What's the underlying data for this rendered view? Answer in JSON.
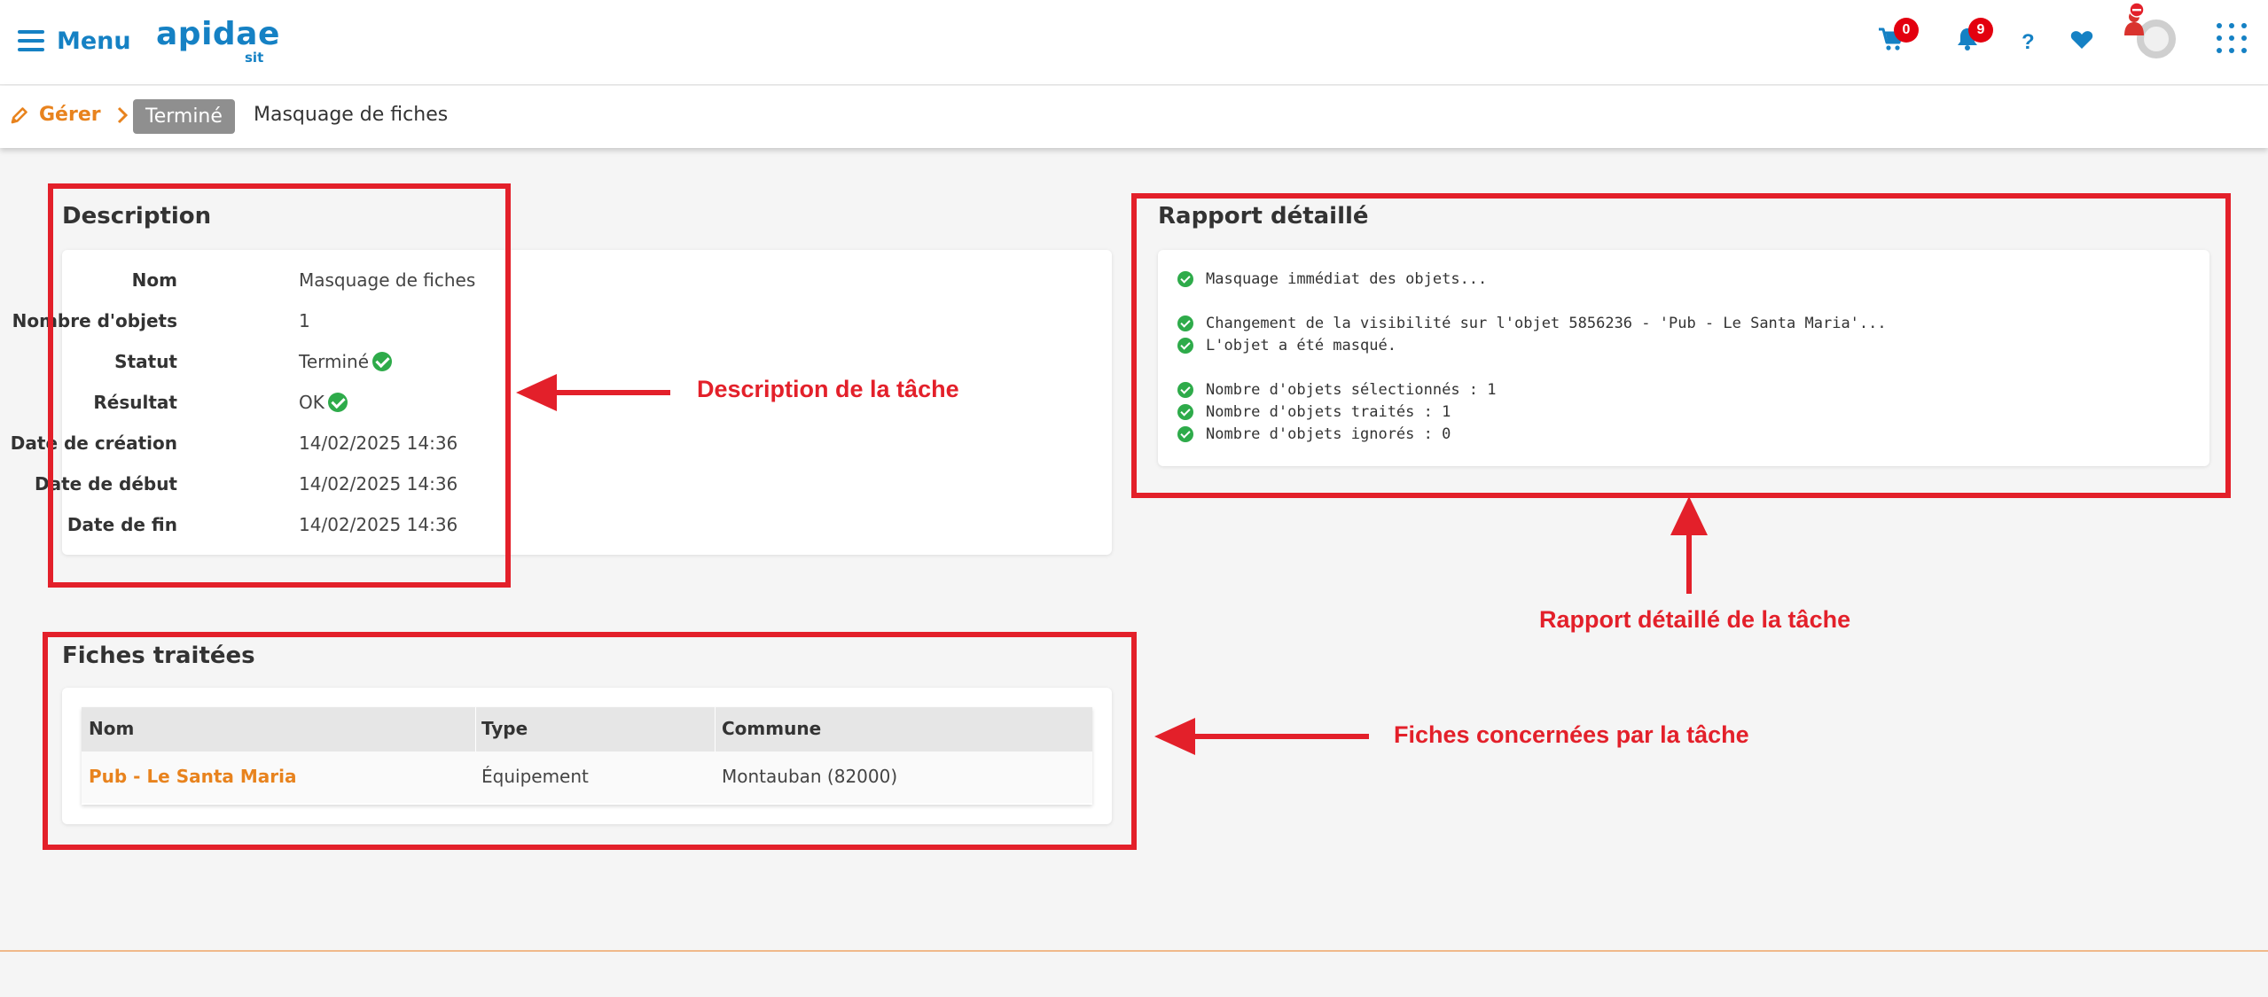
{
  "topbar": {
    "menu_label": "Menu",
    "logo_text": "apidae",
    "logo_sub": "sit",
    "cart_count": "0",
    "notif_count": "9",
    "help_label": "?",
    "accent_color": "#1581c4",
    "badge_color": "#e3000f"
  },
  "breadcrumb": {
    "root": "Gérer",
    "status": "Terminé",
    "current": "Masquage de fiches"
  },
  "description": {
    "title": "Description",
    "rows": [
      {
        "label": "Nom",
        "value": "Masquage de fiches"
      },
      {
        "label": "Nombre d'objets",
        "value": "1"
      },
      {
        "label": "Statut",
        "value": "Terminé"
      },
      {
        "label": "Résultat",
        "value": "OK"
      },
      {
        "label": "Date de création",
        "value": "14/02/2025 14:36"
      },
      {
        "label": "Date de début",
        "value": "14/02/2025 14:36"
      },
      {
        "label": "Date de fin",
        "value": "14/02/2025 14:36"
      }
    ]
  },
  "report": {
    "title": "Rapport détaillé",
    "lines": [
      "Masquage immédiat des objets...",
      "Changement de la visibilité sur l'objet 5856236 - 'Pub - Le Santa Maria'...",
      "L'objet a été masqué.",
      "Nombre d'objets sélectionnés : 1",
      "Nombre d'objets traités : 1",
      "Nombre d'objets ignorés : 0"
    ]
  },
  "fiches": {
    "title": "Fiches traitées",
    "columns": [
      "Nom",
      "Type",
      "Commune"
    ],
    "rows": [
      {
        "nom": "Pub - Le Santa Maria",
        "type": "Équipement",
        "commune": "Montauban (82000)"
      }
    ]
  },
  "annotations": {
    "description": "Description de la tâche",
    "report": "Rapport détaillé de la tâche",
    "fiches": "Fiches concernées par la tâche",
    "color": "#e3202a"
  },
  "icons": {
    "menu": "hamburger-icon",
    "cart": "cart-icon",
    "notifications": "bell-icon",
    "help": "help-icon",
    "favorites": "heart-icon",
    "apps": "grid-icon",
    "edit": "pencil-icon",
    "status_ok": "check-circle-icon"
  }
}
